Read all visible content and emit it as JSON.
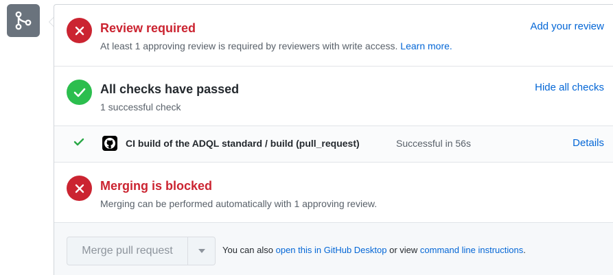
{
  "review": {
    "title": "Review required",
    "description": "At least 1 approving review is required by reviewers with write access.",
    "learn_more": "Learn more.",
    "action": "Add your review"
  },
  "checks": {
    "title": "All checks have passed",
    "description": "1 successful check",
    "action": "Hide all checks"
  },
  "ci": {
    "name": "CI build of the ADQL standard / build (pull_request)",
    "status": "Successful in 56s",
    "action": "Details"
  },
  "blocked": {
    "title": "Merging is blocked",
    "description": "Merging can be performed automatically with 1 approving review."
  },
  "merge": {
    "button_label": "Merge pull request",
    "note_prefix": "You can also",
    "desktop_link": "open this in GitHub Desktop",
    "note_middle": "or view",
    "cli_link": "command line instructions",
    "note_suffix": "."
  },
  "colors": {
    "error_red": "#cb2431",
    "success_green": "#2cbe4e",
    "link_blue": "#0366d6",
    "badge_gray": "#6a737d"
  },
  "icons": {
    "merge": "git-merge-icon",
    "error": "x-circle-icon",
    "success": "check-circle-icon",
    "check": "check-icon",
    "github": "github-logo-icon",
    "caret": "caret-down-icon"
  }
}
